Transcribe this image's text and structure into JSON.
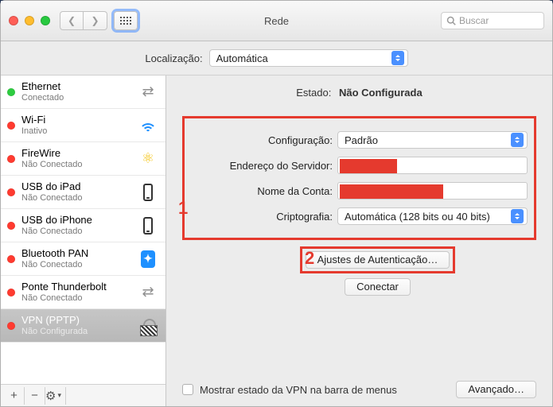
{
  "window": {
    "title": "Rede"
  },
  "search": {
    "placeholder": "Buscar"
  },
  "location": {
    "label": "Localização:",
    "value": "Automática"
  },
  "sidebar": {
    "items": [
      {
        "name": "Ethernet",
        "status": "Conectado",
        "dot": "green",
        "icon": "ethernet"
      },
      {
        "name": "Wi-Fi",
        "status": "Inativo",
        "dot": "red",
        "icon": "wifi"
      },
      {
        "name": "FireWire",
        "status": "Não Conectado",
        "dot": "red",
        "icon": "firewire"
      },
      {
        "name": "USB do iPad",
        "status": "Não Conectado",
        "dot": "red",
        "icon": "iphone"
      },
      {
        "name": "USB do iPhone",
        "status": "Não Conectado",
        "dot": "red",
        "icon": "iphone"
      },
      {
        "name": "Bluetooth PAN",
        "status": "Não Conectado",
        "dot": "red",
        "icon": "bluetooth"
      },
      {
        "name": "Ponte Thunderbolt",
        "status": "Não Conectado",
        "dot": "red",
        "icon": "ethernet"
      },
      {
        "name": "VPN (PPTP)",
        "status": "Não Configurada",
        "dot": "red",
        "icon": "lock",
        "selected": true
      }
    ]
  },
  "content": {
    "state_label": "Estado:",
    "state_value": "Não Configurada",
    "marker1": "1",
    "marker2": "2",
    "config": {
      "label": "Configuração:",
      "value": "Padrão"
    },
    "server": {
      "label": "Endereço do Servidor:"
    },
    "account": {
      "label": "Nome da Conta:"
    },
    "crypto": {
      "label": "Criptografia:",
      "value": "Automática (128 bits ou 40 bits)"
    },
    "auth_button": "Ajustes de Autenticação…",
    "connect_button": "Conectar",
    "show_in_menu": "Mostrar estado da VPN na barra de menus",
    "advanced_button": "Avançado…"
  }
}
